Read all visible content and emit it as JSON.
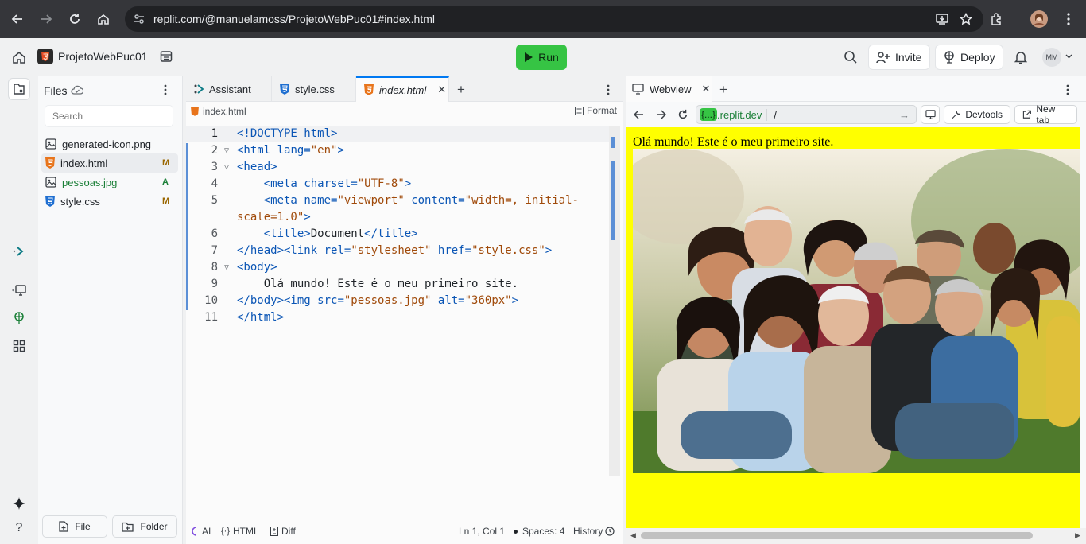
{
  "browser": {
    "url": "replit.com/@manuelamoss/ProjetoWebPuc01#index.html"
  },
  "app": {
    "project_name": "ProjetoWebPuc01",
    "run_label": "Run",
    "invite_label": "Invite",
    "deploy_label": "Deploy",
    "avatar_initials": "MM"
  },
  "files": {
    "title": "Files",
    "search_placeholder": "Search",
    "items": [
      {
        "name": "generated-icon.png",
        "status": ""
      },
      {
        "name": "index.html",
        "status": "M"
      },
      {
        "name": "pessoas.jpg",
        "status": "A"
      },
      {
        "name": "style.css",
        "status": "M"
      }
    ],
    "new_file_label": "File",
    "new_folder_label": "Folder"
  },
  "editor": {
    "tabs": [
      {
        "label": "Assistant"
      },
      {
        "label": "style.css"
      },
      {
        "label": "index.html"
      }
    ],
    "breadcrumb": "index.html",
    "format_label": "Format",
    "line_numbers": [
      "1",
      "2",
      "3",
      "4",
      "5",
      "",
      "6",
      "7",
      "8",
      "9",
      "10",
      "11"
    ],
    "status": {
      "ai": "AI",
      "lang": "HTML",
      "diff": "Diff",
      "position": "Ln 1, Col 1",
      "spaces": "Spaces: 4",
      "history": "History"
    }
  },
  "webview": {
    "tab_label": "Webview",
    "domain_badge": "{...}",
    "domain": ".replit.dev",
    "path": "/",
    "devtools_label": "Devtools",
    "newtab_label": "New tab",
    "site_text": "Olá mundo! Este é o meu primeiro site."
  },
  "colors": {
    "run_green": "#36c444",
    "site_background": "#ffff00",
    "accent_blue": "#0079f2"
  }
}
